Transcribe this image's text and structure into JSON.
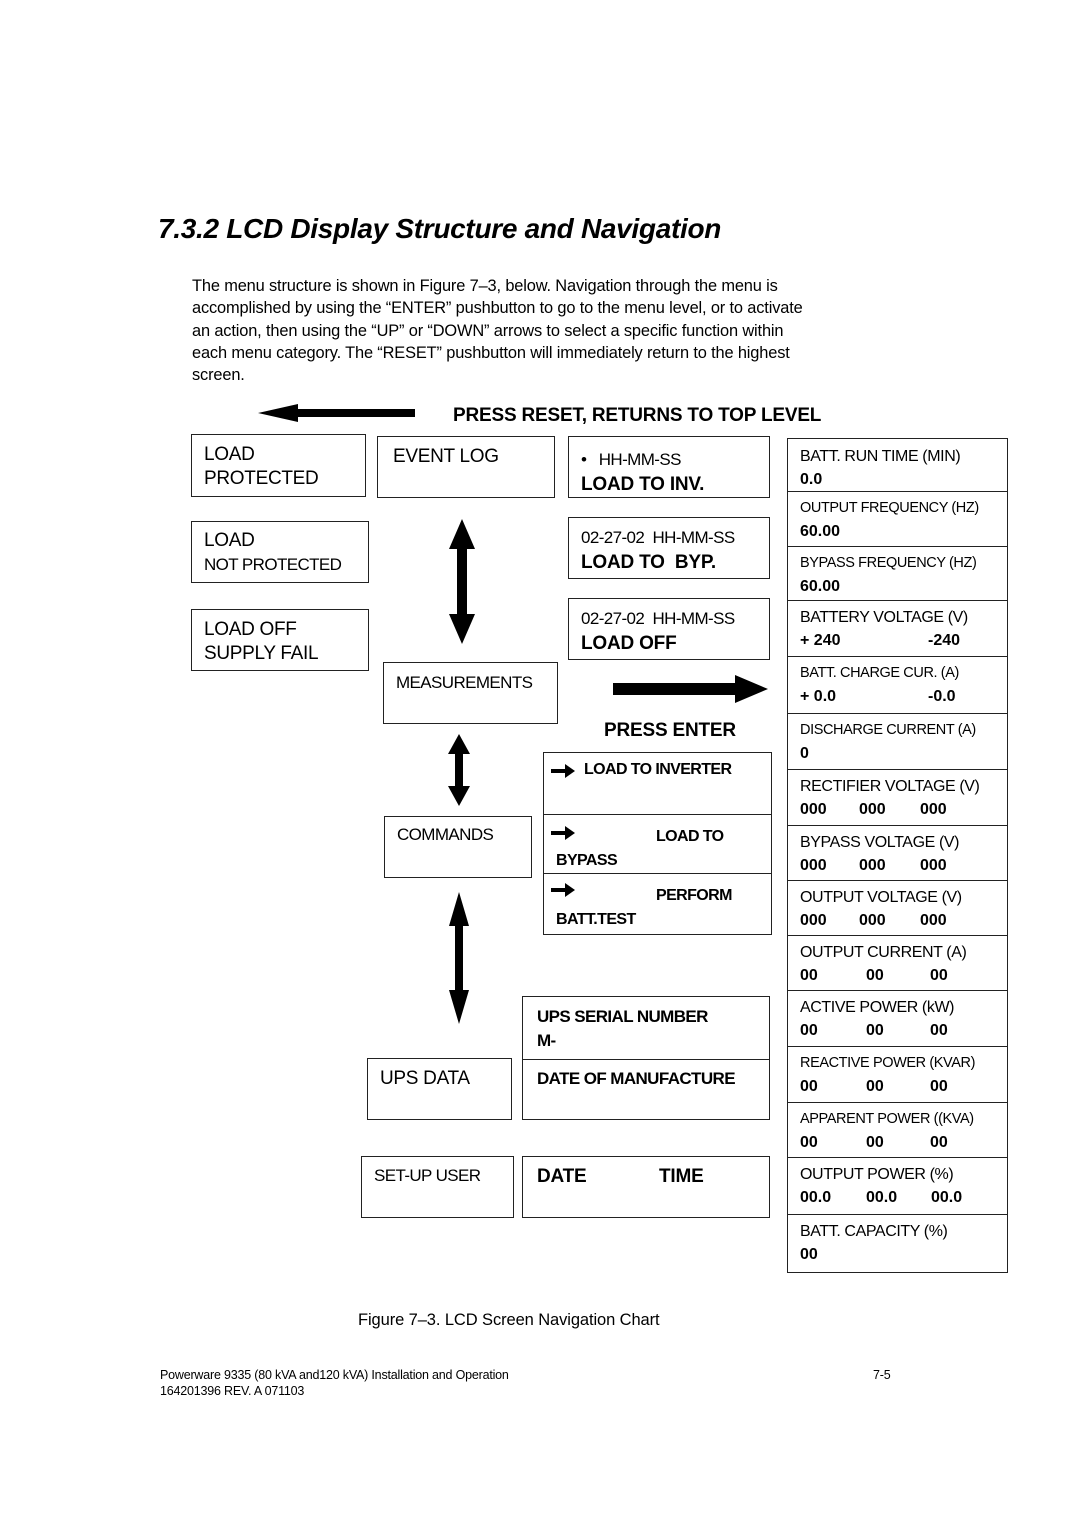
{
  "section": {
    "heading": "7.3.2  LCD Display Structure and Navigation",
    "paragraph": [
      "The menu structure is shown in Figure 7–3, below.  Navigation through the menu is",
      "accomplished by using the “ENTER” pushbutton to go to the menu level, or to activate",
      "an action, then using the “UP” or “DOWN” arrows to select a specific function within",
      "each menu category.  The “RESET” pushbutton will immediately return to the highest",
      "screen."
    ]
  },
  "figure": {
    "reset_label": "PRESS RESET, RETURNS TO TOP LEVEL",
    "enter_label": "PRESS ENTER",
    "status_screens": [
      {
        "line1": "LOAD",
        "line2": "PROTECTED"
      },
      {
        "line1": "LOAD",
        "line2": "NOT PROTECTED"
      },
      {
        "line1": "LOAD OFF",
        "line2": "SUPPLY FAIL"
      }
    ],
    "menus": {
      "event_log": "EVENT LOG",
      "measurements": "MEASUREMENTS",
      "commands": "COMMANDS",
      "ups_data": "UPS DATA",
      "setup_user": "SET-UP USER"
    },
    "event_log_entries": [
      {
        "bullet": "•",
        "date": "",
        "time": "HH-MM-SS",
        "event": "LOAD TO INV."
      },
      {
        "bullet": "",
        "date": "02-27-02",
        "time": "HH-MM-SS",
        "event": "LOAD TO  BYP."
      },
      {
        "bullet": "",
        "date": "02-27-02",
        "time": "HH-MM-SS",
        "event": "LOAD OFF"
      }
    ],
    "commands": [
      {
        "line1": "LOAD TO INVERTER",
        "line2": ""
      },
      {
        "line1": "LOAD TO",
        "line2": "BYPASS"
      },
      {
        "line1": "PERFORM",
        "line2": "BATT.TEST"
      }
    ],
    "ups_data": {
      "serial_label": "UPS SERIAL NUMBER",
      "serial_value": "M-",
      "manufacture_label": "DATE OF MANUFACTURE"
    },
    "setup_user": {
      "date_label": "DATE",
      "time_label": "TIME"
    },
    "measurements": [
      {
        "label": "BATT. RUN TIME (MIN)",
        "values": [
          "0.0"
        ]
      },
      {
        "label": "OUTPUT FREQUENCY (HZ)",
        "values": [
          "60.00"
        ]
      },
      {
        "label": "BYPASS FREQUENCY (HZ)",
        "values": [
          "60.00"
        ]
      },
      {
        "label": "BATTERY VOLTAGE (V)",
        "values": [
          "+ 240",
          "-240"
        ]
      },
      {
        "label": "BATT. CHARGE CUR. (A)",
        "values": [
          "+ 0.0",
          "-0.0"
        ]
      },
      {
        "label": "DISCHARGE CURRENT (A)",
        "values": [
          "0"
        ]
      },
      {
        "label": "RECTIFIER VOLTAGE (V)",
        "values": [
          "000",
          "000",
          "000"
        ]
      },
      {
        "label": "BYPASS VOLTAGE (V)",
        "values": [
          "000",
          "000",
          "000"
        ]
      },
      {
        "label": "OUTPUT VOLTAGE (V)",
        "values": [
          "000",
          "000",
          "000"
        ]
      },
      {
        "label": "OUTPUT CURRENT (A)",
        "values": [
          "00",
          "00",
          "00"
        ]
      },
      {
        "label": "ACTIVE POWER (kW)",
        "values": [
          "00",
          "00",
          "00"
        ]
      },
      {
        "label": "REACTIVE POWER (KVAR)",
        "values": [
          "00",
          "00",
          "00"
        ]
      },
      {
        "label": "APPARENT POWER ((KVA)",
        "values": [
          "00",
          "00",
          "00"
        ]
      },
      {
        "label": "OUTPUT POWER (%)",
        "values": [
          "00.0",
          "00.0",
          "00.0"
        ]
      },
      {
        "label": "BATT. CAPACITY (%)",
        "values": [
          "00"
        ]
      }
    ],
    "caption": "Figure 7–3.  LCD Screen Navigation Chart"
  },
  "footer": {
    "title": "Powerware 9335 (80 kVA and120 kVA) Installation and Operation",
    "doc_number": "164201396 REV. A  071103",
    "page": "7-5"
  },
  "icons": {
    "reset_arrow": "arrow-left-icon",
    "enter_arrow": "arrow-right-icon",
    "nav_arrows": "arrow-up-down-icon",
    "command_arrow": "arrow-right-small-icon"
  }
}
